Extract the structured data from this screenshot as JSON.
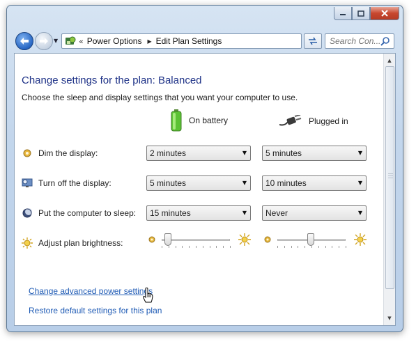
{
  "window": {
    "caption_buttons": {
      "minimize": "▭",
      "maximize": "▢",
      "close": "✕"
    }
  },
  "navbar": {
    "breadcrumb": [
      "Power Options",
      "Edit Plan Settings"
    ],
    "breadcrumb_prefix": "«",
    "search_placeholder": "Search Con...",
    "back_icon": "arrow-left-icon",
    "forward_icon": "arrow-right-icon",
    "refresh_icon": "refresh-icon"
  },
  "main": {
    "heading": "Change settings for the plan: Balanced",
    "subtitle": "Choose the sleep and display settings that you want your computer to use.",
    "columns": {
      "battery": "On battery",
      "plugged": "Plugged in"
    },
    "rows": [
      {
        "label": "Dim the display:",
        "battery": "2 minutes",
        "plugged": "5 minutes",
        "icon": "dim-display-icon"
      },
      {
        "label": "Turn off the display:",
        "battery": "5 minutes",
        "plugged": "10 minutes",
        "icon": "monitor-icon"
      },
      {
        "label": "Put the computer to sleep:",
        "battery": "15 minutes",
        "plugged": "Never",
        "icon": "sleep-moon-icon"
      }
    ],
    "brightness": {
      "label": "Adjust plan brightness:",
      "battery_level": 0.05,
      "plugged_level": 0.45
    },
    "links": {
      "advanced": "Change advanced power settings",
      "restore": "Restore default settings for this plan"
    }
  },
  "colors": {
    "heading": "#1e3287",
    "link": "#1f5bb5",
    "chrome": "#c3d6ec"
  }
}
